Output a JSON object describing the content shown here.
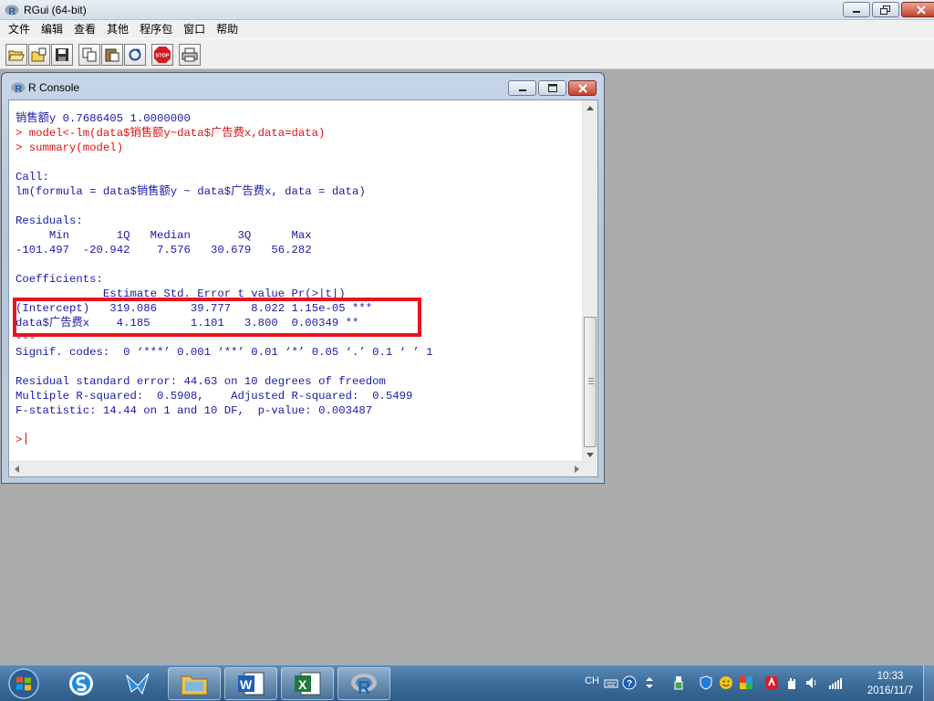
{
  "app": {
    "title": "RGui (64-bit)"
  },
  "menu": [
    "文件",
    "编辑",
    "查看",
    "其他",
    "程序包",
    "窗口",
    "帮助"
  ],
  "toolbar": {
    "buttons": [
      "open-script-icon",
      "load-workspace-icon",
      "save-icon",
      "copy-icon",
      "paste-icon",
      "refresh-icon",
      "stop-icon",
      "print-icon"
    ],
    "stop_label": "STOP"
  },
  "console": {
    "title": "R Console",
    "lines": [
      {
        "text": "销售额y 0.7686405 1.0000000",
        "type": "output"
      },
      {
        "text": "> model<-lm(data$销售额y~data$广告费x,data=data)",
        "type": "command"
      },
      {
        "text": "> summary(model)",
        "type": "command"
      },
      {
        "text": "",
        "type": "output"
      },
      {
        "text": "Call:",
        "type": "output"
      },
      {
        "text": "lm(formula = data$销售额y ~ data$广告费x, data = data)",
        "type": "output"
      },
      {
        "text": "",
        "type": "output"
      },
      {
        "text": "Residuals:",
        "type": "output"
      },
      {
        "text": "     Min       1Q   Median       3Q      Max ",
        "type": "output"
      },
      {
        "text": "-101.497  -20.942    7.576   30.679   56.282 ",
        "type": "output"
      },
      {
        "text": "",
        "type": "output"
      },
      {
        "text": "Coefficients:",
        "type": "output"
      },
      {
        "text": "             Estimate Std. Error t value Pr(>|t|)    ",
        "type": "output"
      },
      {
        "text": "(Intercept)   319.086     39.777   8.022 1.15e-05 ***",
        "type": "output"
      },
      {
        "text": "data$广告费x    4.185      1.101   3.800  0.00349 ** ",
        "type": "output"
      },
      {
        "text": "---",
        "type": "output"
      },
      {
        "text": "Signif. codes:  0 ‘***’ 0.001 ‘**’ 0.01 ‘*’ 0.05 ‘.’ 0.1 ‘ ’ 1",
        "type": "output"
      },
      {
        "text": "",
        "type": "output"
      },
      {
        "text": "Residual standard error: 44.63 on 10 degrees of freedom",
        "type": "output"
      },
      {
        "text": "Multiple R-squared:  0.5908,\tAdjusted R-squared:  0.5499 ",
        "type": "output"
      },
      {
        "text": "F-statistic: 14.44 on 1 and 10 DF,  p-value: 0.003487",
        "type": "output"
      },
      {
        "text": "",
        "type": "output"
      }
    ],
    "prompt": ">"
  },
  "colors": {
    "output_text": "#1a1aa6",
    "command_text": "#e01010",
    "highlight": "#e8141e"
  },
  "taskbar": {
    "apps": [
      "sogou-input-icon",
      "feiq-messenger-icon",
      "file-explorer-icon",
      "word-icon",
      "excel-icon",
      "r-icon"
    ],
    "tray": {
      "language": "CH",
      "time": "10:33",
      "date": "2016/11/7"
    }
  }
}
